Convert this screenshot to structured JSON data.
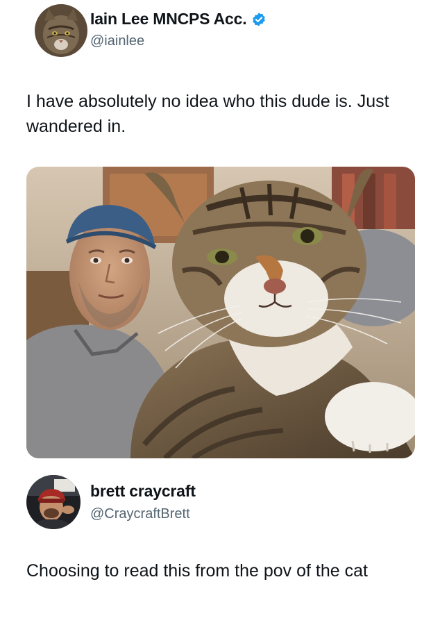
{
  "posts": [
    {
      "display_name": "Iain Lee MNCPS Acc.",
      "handle": "@iainlee",
      "verified": true,
      "text": "I have absolutely no idea who this dude is. Just wandered in.",
      "avatar_icon": "cat-avatar-icon",
      "media_icon": "cat-selfie-photo"
    },
    {
      "display_name": "brett craycraft",
      "handle": "@CraycraftBrett",
      "verified": false,
      "text": "Choosing to read this from the pov of the cat",
      "avatar_icon": "person-avatar-icon"
    }
  ],
  "colors": {
    "verified_blue": "#1d9bf0",
    "handle_gray": "#536471",
    "text": "#0f1419"
  }
}
